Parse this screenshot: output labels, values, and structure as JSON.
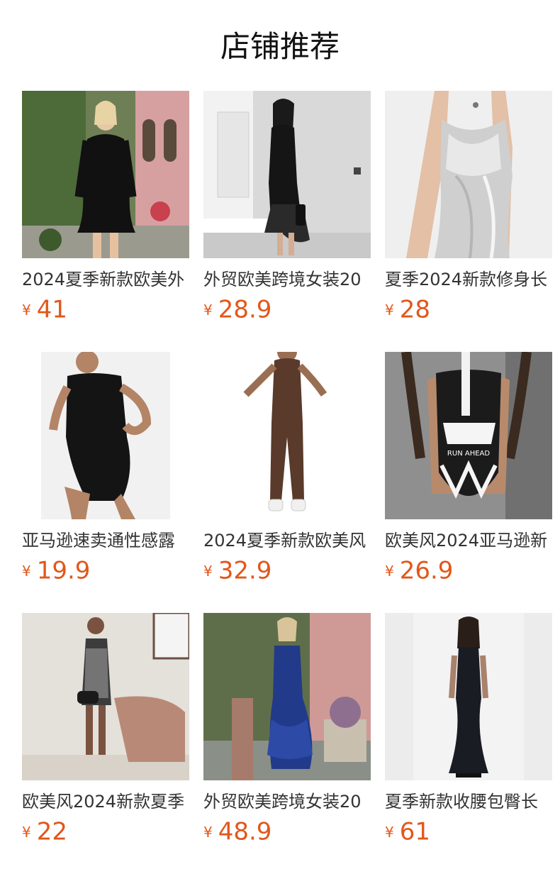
{
  "section": {
    "title": "店铺推荐"
  },
  "currency": "¥",
  "products": [
    {
      "name": "2024夏季新款欧美外",
      "price": "41",
      "image": "black-mini-dress-garden-photo"
    },
    {
      "name": "外贸欧美跨境女装20",
      "price": "28.9",
      "image": "black-ruffle-hem-dress-photo"
    },
    {
      "name": "夏季2024新款修身长",
      "price": "28",
      "image": "silver-satin-slip-dress-photo"
    },
    {
      "name": "亚马逊速卖通性感露",
      "price": "19.9",
      "image": "black-romper-photo"
    },
    {
      "name": "2024夏季新款欧美风",
      "price": "32.9",
      "image": "brown-jumpsuit-photo"
    },
    {
      "name": "欧美风2024亚马逊新",
      "price": "26.9",
      "image": "printed-swimsuit-photo"
    },
    {
      "name": "欧美风2024新款夏季",
      "price": "22",
      "image": "printed-mini-dress-photo"
    },
    {
      "name": "外贸欧美跨境女装20",
      "price": "48.9",
      "image": "blue-ruffle-gown-photo"
    },
    {
      "name": "夏季新款收腰包臀长",
      "price": "61",
      "image": "black-mermaid-dress-photo"
    }
  ]
}
